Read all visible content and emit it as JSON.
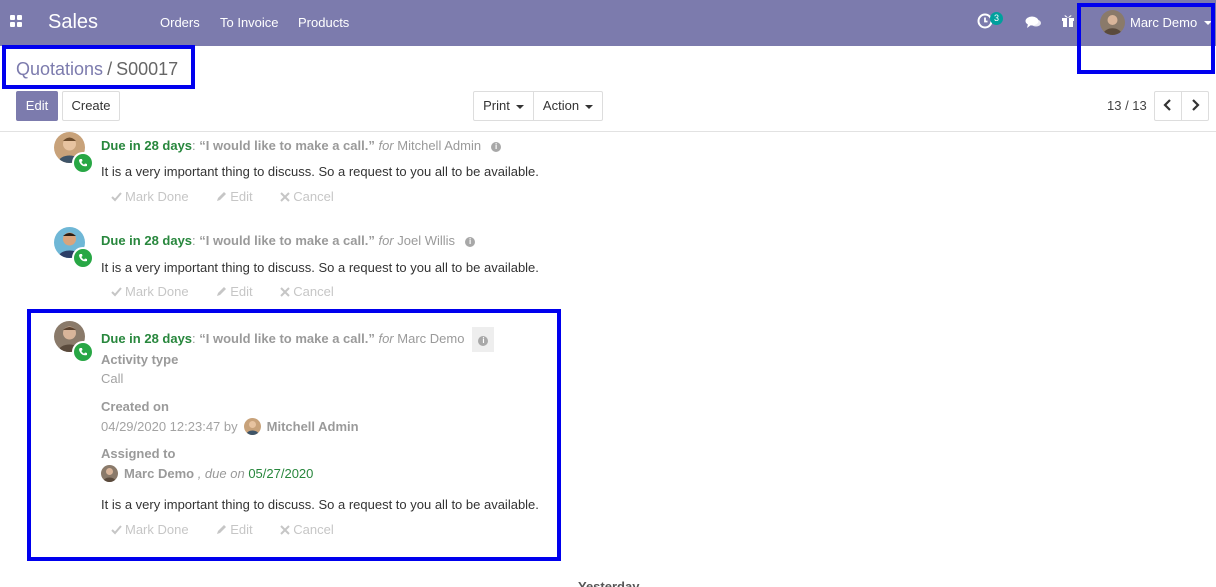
{
  "navbar": {
    "app_name": "Sales",
    "menu": [
      "Orders",
      "To Invoice",
      "Products"
    ],
    "activity_count": "3",
    "user_name": "Marc Demo",
    "accent": "#7c7bad"
  },
  "breadcrumb": {
    "parent": "Quotations",
    "separator": "/",
    "current": "S00017"
  },
  "buttons": {
    "edit": "Edit",
    "create": "Create",
    "print": "Print",
    "action": "Action"
  },
  "pager": {
    "value": "13 / 13"
  },
  "activity_actions": {
    "mark_done": "Mark Done",
    "edit": "Edit",
    "cancel": "Cancel"
  },
  "activities": [
    {
      "due": "Due in 28 days",
      "summary": "“I would like to make a call.”",
      "for_label": "for",
      "assignee": "Mitchell Admin",
      "note": "It is a very important thing to discuss. So a request to you all to be available."
    },
    {
      "due": "Due in 28 days",
      "summary": "“I would like to make a call.”",
      "for_label": "for",
      "assignee": "Joel Willis",
      "note": "It is a very important thing to discuss. So a request to you all to be available."
    },
    {
      "due": "Due in 28 days",
      "summary": "“I would like to make a call.”",
      "for_label": "for",
      "assignee": "Marc Demo",
      "activity_type_label": "Activity type",
      "activity_type": "Call",
      "created_on_label": "Created on",
      "created_on": "04/29/2020 12:23:47 by",
      "created_by": "Mitchell Admin",
      "assigned_to_label": "Assigned to",
      "assigned_to": "Marc Demo",
      "due_on_label": ", due on",
      "due_date": "05/27/2020",
      "note": "It is a very important thing to discuss. So a request to you all to be available."
    }
  ],
  "day_separator": "Yesterday"
}
